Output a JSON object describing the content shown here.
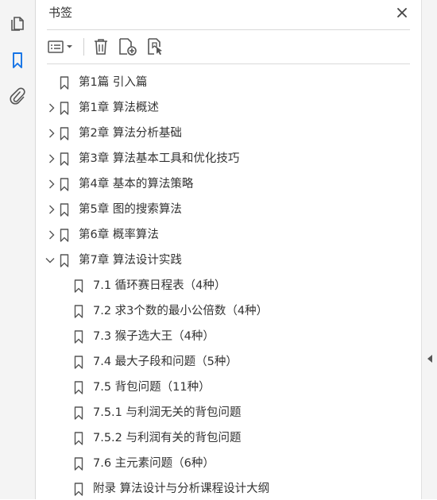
{
  "panel": {
    "title": "书签"
  },
  "left_rail": {
    "items": [
      {
        "icon": "pages-icon",
        "active": false
      },
      {
        "icon": "bookmark-icon",
        "active": true
      },
      {
        "icon": "paperclip-icon",
        "active": false
      }
    ]
  },
  "toolbar": {
    "buttons": [
      "options-menu-icon",
      "delete-icon",
      "new-bookmark-icon",
      "bookmark-from-selection-icon"
    ]
  },
  "colors": {
    "accent": "#1473e6",
    "icon": "#555555",
    "text": "#333333",
    "divider": "#d9d9d9"
  },
  "bookmarks": [
    {
      "label": "第1篇  引入篇",
      "level": 0,
      "expander": "none"
    },
    {
      "label": "第1章  算法概述",
      "level": 0,
      "expander": "collapsed"
    },
    {
      "label": "第2章  算法分析基础",
      "level": 0,
      "expander": "collapsed"
    },
    {
      "label": "第3章  算法基本工具和优化技巧",
      "level": 0,
      "expander": "collapsed"
    },
    {
      "label": "第4章  基本的算法策略",
      "level": 0,
      "expander": "collapsed"
    },
    {
      "label": "第5章  图的搜索算法",
      "level": 0,
      "expander": "collapsed"
    },
    {
      "label": "第6章  概率算法",
      "level": 0,
      "expander": "collapsed"
    },
    {
      "label": "第7章  算法设计实践",
      "level": 0,
      "expander": "expanded"
    },
    {
      "label": "7.1  循环赛日程表（4种）",
      "level": 1,
      "expander": "none"
    },
    {
      "label": "7.2  求3个数的最小公倍数（4种）",
      "level": 1,
      "expander": "none"
    },
    {
      "label": "7.3  猴子选大王（4种）",
      "level": 1,
      "expander": "none"
    },
    {
      "label": "7.4  最大子段和问题（5种）",
      "level": 1,
      "expander": "none"
    },
    {
      "label": "7.5  背包问题（11种）",
      "level": 1,
      "expander": "none"
    },
    {
      "label": "7.5.1  与利润无关的背包问题",
      "level": 1,
      "expander": "none"
    },
    {
      "label": "7.5.2  与利润有关的背包问题",
      "level": 1,
      "expander": "none"
    },
    {
      "label": "7.6  主元素问题（6种）",
      "level": 1,
      "expander": "none"
    },
    {
      "label": "附录  算法设计与分析课程设计大纲",
      "level": 1,
      "expander": "none"
    }
  ]
}
